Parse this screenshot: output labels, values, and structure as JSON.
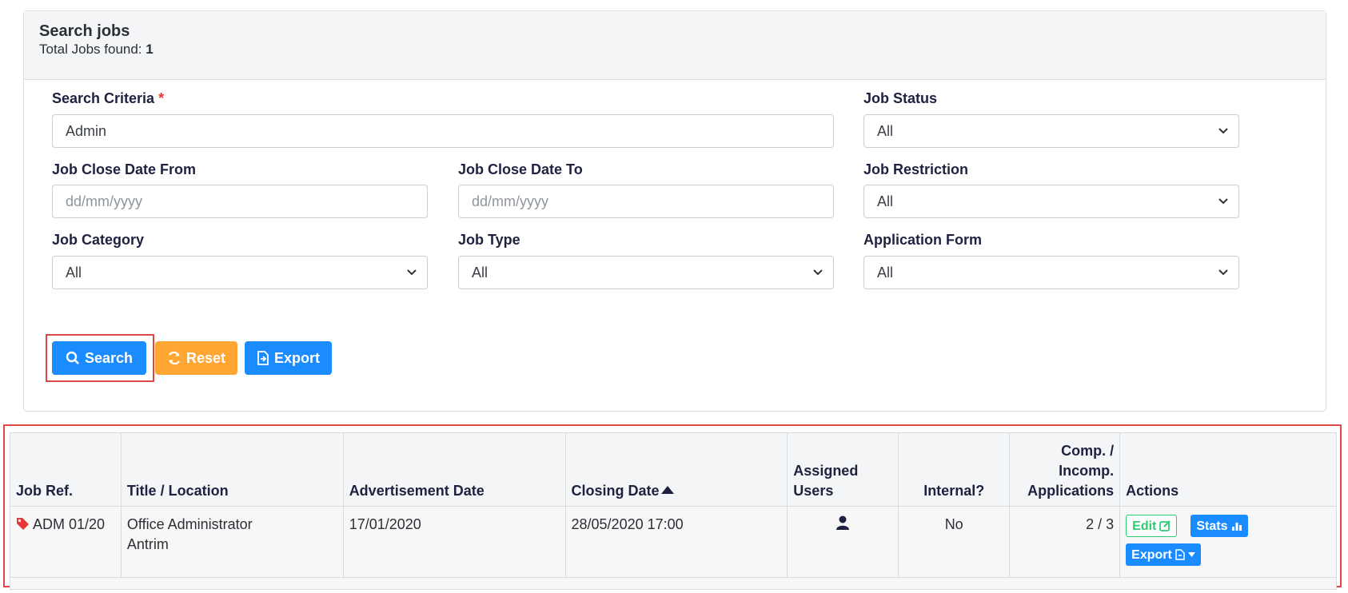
{
  "header": {
    "title": "Search jobs",
    "total_label": "Total Jobs found: ",
    "total_value": "1"
  },
  "form": {
    "search_criteria": {
      "label": "Search Criteria",
      "required_mark": "*",
      "value": "Admin"
    },
    "job_status": {
      "label": "Job Status",
      "value": "All"
    },
    "close_from": {
      "label": "Job Close Date From",
      "placeholder": "dd/mm/yyyy"
    },
    "close_to": {
      "label": "Job Close Date To",
      "placeholder": "dd/mm/yyyy"
    },
    "job_restriction": {
      "label": "Job Restriction",
      "value": "All"
    },
    "job_category": {
      "label": "Job Category",
      "value": "All"
    },
    "job_type": {
      "label": "Job Type",
      "value": "All"
    },
    "application_form": {
      "label": "Application Form",
      "value": "All"
    }
  },
  "buttons": {
    "search": "Search",
    "reset": "Reset",
    "export": "Export"
  },
  "table": {
    "headers": {
      "job_ref": "Job Ref.",
      "title_location": "Title / Location",
      "advert_date": "Advertisement Date",
      "closing_date": "Closing Date",
      "assigned_1": "Assigned",
      "assigned_2": "Users",
      "internal": "Internal?",
      "comp_1": "Comp. /",
      "comp_2": "Incomp.",
      "comp_3": "Applications",
      "actions": "Actions"
    },
    "rows": [
      {
        "job_ref": "ADM 01/20",
        "title": "Office Administrator",
        "location": "Antrim",
        "advert_date": "17/01/2020",
        "closing_date": "28/05/2020 17:00",
        "internal": "No",
        "applications": "2 / 3",
        "actions": {
          "edit": "Edit",
          "stats": "Stats",
          "export": "Export"
        }
      }
    ]
  },
  "colors": {
    "primary": "#1a8cff",
    "warning": "#ffa732",
    "success": "#2ecc71",
    "highlight": "#e04848"
  }
}
